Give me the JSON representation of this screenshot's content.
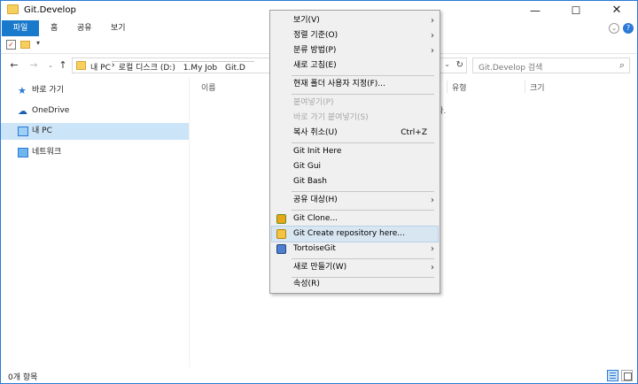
{
  "window": {
    "title": "Git.Develop",
    "min_glyph": "—",
    "max_glyph": "☐",
    "close_glyph": "✕"
  },
  "ribbon": {
    "tabs": [
      "파일",
      "홈",
      "공유",
      "보기"
    ],
    "expand_glyph": "⌄",
    "help_glyph": "?"
  },
  "qat": {
    "check_glyph": "✓",
    "dropdown_glyph": "▾"
  },
  "nav": {
    "back_glyph": "←",
    "forward_glyph": "→",
    "recent_glyph": "⌄",
    "up_glyph": "↑"
  },
  "address": {
    "crumbs": [
      "내 PC",
      "로컬 디스크 (D:)",
      "1.My Job",
      "Git.D"
    ],
    "separator": "›",
    "dropdown_glyph": "⌄",
    "refresh_glyph": "↻"
  },
  "search": {
    "placeholder": "Git.Develop 검색",
    "icon_glyph": "⌕"
  },
  "sidebar": {
    "items": [
      {
        "label": "바로 가기",
        "icon": "star-icon",
        "glyph": "★"
      },
      {
        "label": "OneDrive",
        "icon": "cloud-icon",
        "glyph": "☁"
      },
      {
        "label": "내 PC",
        "icon": "pc-icon",
        "glyph": ""
      },
      {
        "label": "네트워크",
        "icon": "network-icon",
        "glyph": ""
      }
    ]
  },
  "content": {
    "columns": [
      "이름",
      "유형",
      "크기"
    ],
    "empty_message_tail": "니다."
  },
  "status": {
    "item_count": "0개 항목"
  },
  "context_menu": {
    "items": [
      {
        "label": "보기(V)",
        "submenu": true
      },
      {
        "label": "정렬 기준(O)",
        "submenu": true
      },
      {
        "label": "분류 방법(P)",
        "submenu": true
      },
      {
        "label": "새로 고침(E)"
      },
      {
        "label": "현재 폴더 사용자 지정(F)..."
      },
      {
        "label": "붙여넣기(P)",
        "disabled": true
      },
      {
        "label": "바로 가기 붙여넣기(S)",
        "disabled": true
      },
      {
        "label": "복사 취소(U)",
        "shortcut": "Ctrl+Z"
      },
      {
        "label": "Git Init Here"
      },
      {
        "label": "Git Gui"
      },
      {
        "label": "Git Bash"
      },
      {
        "label": "공유 대상(H)",
        "submenu": true
      },
      {
        "label": "Git Clone...",
        "icon": "git-clone-icon"
      },
      {
        "label": "Git Create repository here...",
        "icon": "git-create-icon",
        "highlighted": true
      },
      {
        "label": "TortoiseGit",
        "icon": "tortoisegit-icon",
        "submenu": true
      },
      {
        "label": "새로 만들기(W)",
        "submenu": true
      },
      {
        "label": "속성(R)"
      }
    ],
    "arrow_glyph": "›"
  },
  "colors": {
    "accent": "#1979ca",
    "selection": "#cce4f7",
    "menu_bg": "#f0f0f0",
    "menu_highlight": "#d8e6f2"
  }
}
